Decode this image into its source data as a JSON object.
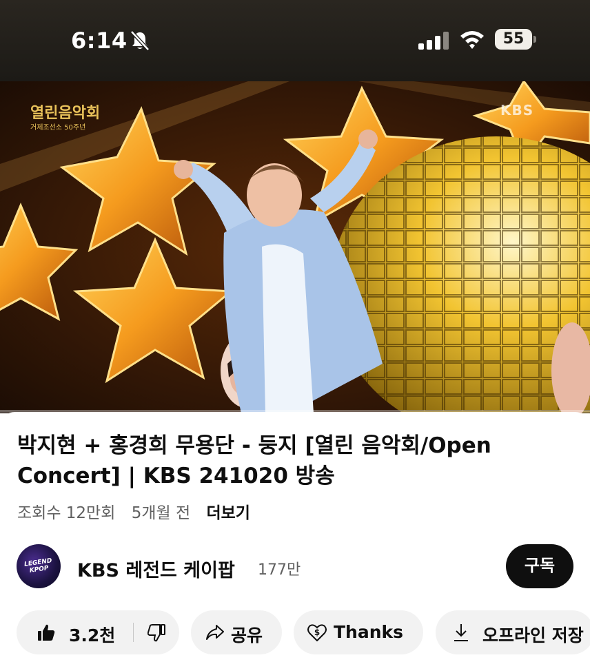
{
  "status_bar": {
    "time": "6:14",
    "battery": "55",
    "battery_level_percent": 55,
    "icons": [
      "bell-mute-icon",
      "cellular-signal-icon",
      "wifi-icon",
      "battery-icon"
    ]
  },
  "video": {
    "overlay_logo": "열린음악회",
    "overlay_subtitle": "거제조선소 50주년",
    "overlay_watermark": "KBS",
    "progress_fraction": 0.0
  },
  "title": "박지현 + 홍경희 무용단 - 둥지 [열린 음악회/Open Concert] | KBS 241020 방송",
  "meta": {
    "views": "조회수 12만회",
    "age": "5개월 전",
    "more": "더보기"
  },
  "channel": {
    "name": "KBS 레전드 케이팝",
    "subscribers": "177만",
    "avatar_text": "LEGEND KPOP",
    "subscribe_label": "구독"
  },
  "actions": {
    "like_count": "3.2천",
    "share_label": "공유",
    "thanks_label": "Thanks",
    "download_label": "오프라인 저장"
  },
  "colors": {
    "progress": "#ff0000",
    "pill_bg": "#f2f2f2",
    "subscribe_bg": "#0f0f0f",
    "meta_text": "#606060"
  }
}
